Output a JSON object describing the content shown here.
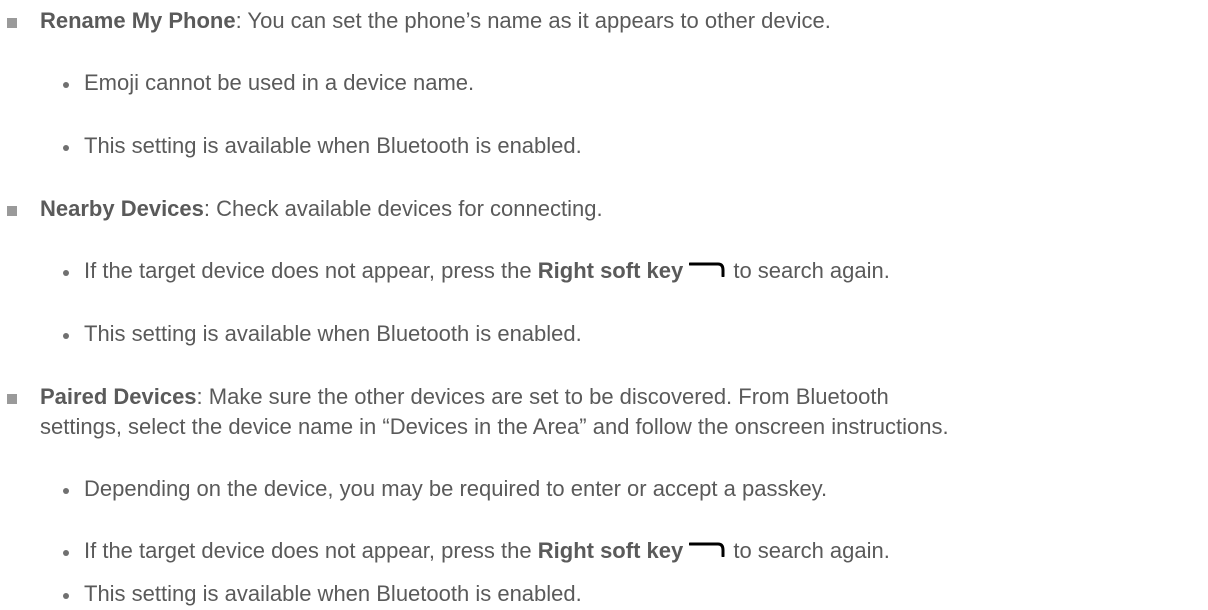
{
  "items": [
    {
      "term": "Rename My Phone",
      "desc": ": You can set the phone’s name as it appears to other device.",
      "subitems": [
        {
          "text": "Emoji cannot be used in a device name."
        },
        {
          "text": "This setting is available when Bluetooth is enabled."
        }
      ]
    },
    {
      "term": "Nearby Devices",
      "desc": ": Check available devices for connecting.",
      "subitems": [
        {
          "pre": "If the target device does not appear, press the ",
          "key": "Right soft key",
          "post": " to search again."
        },
        {
          "text": "This setting is available when Bluetooth is enabled."
        }
      ]
    },
    {
      "term": "Paired Devices",
      "desc": ": Make sure the other devices are set to be discovered. From Bluetooth",
      "desc2": "settings, select the device name in “Devices in the Area” and follow the onscreen instructions.",
      "subitems": [
        {
          "text": "Depending on the device, you may be required to enter or accept a passkey."
        },
        {
          "pre": "If the target device does not appear, press the ",
          "key": "Right soft key",
          "post": " to search again."
        },
        {
          "text": "This setting is available when Bluetooth is enabled."
        }
      ]
    }
  ],
  "icons": {
    "right_soft_key": "right-soft-key-icon"
  }
}
